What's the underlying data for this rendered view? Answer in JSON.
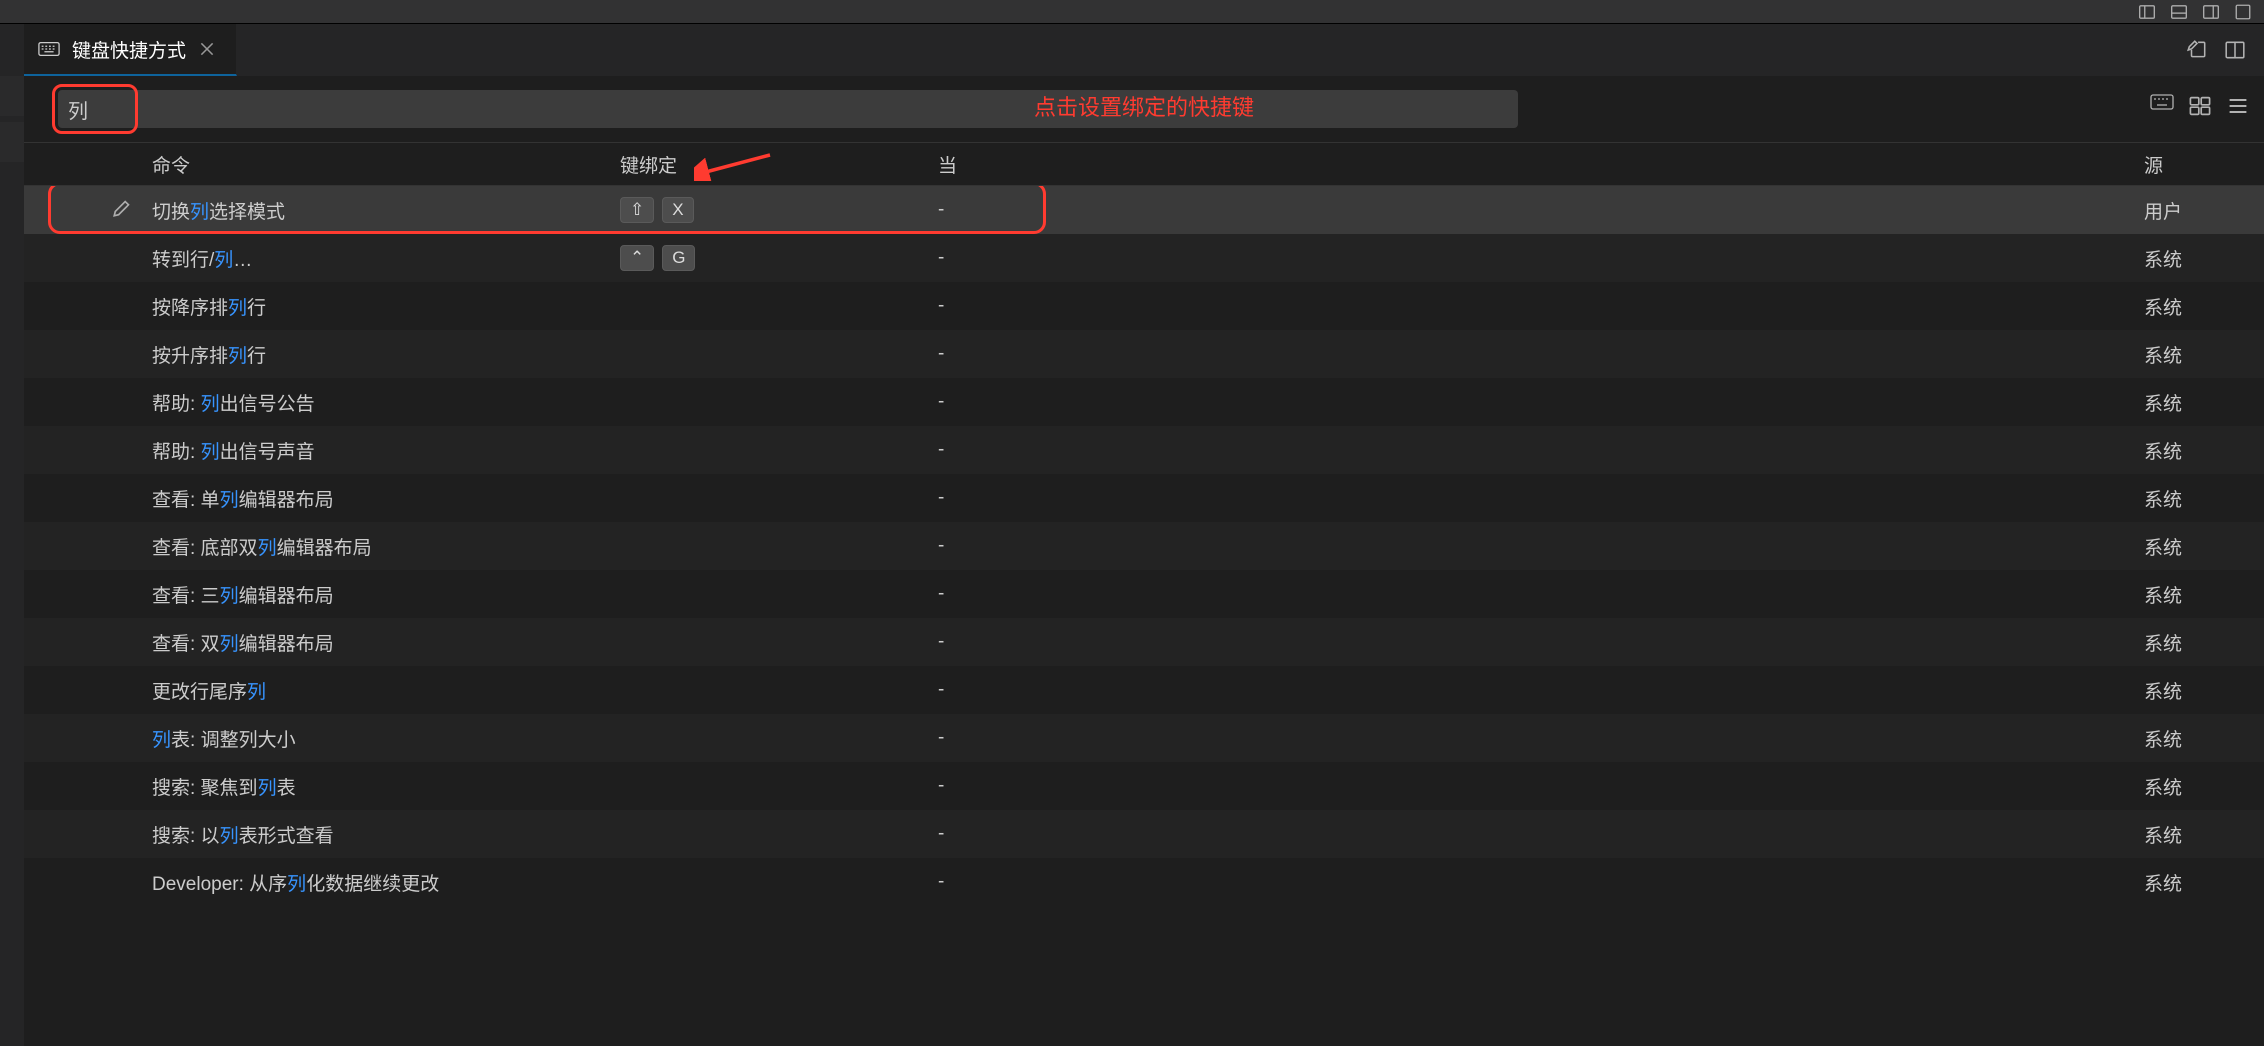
{
  "tab": {
    "title": "键盘快捷方式"
  },
  "search": {
    "value": "列",
    "annotation": "点击设置绑定的快捷键"
  },
  "headers": {
    "command": "命令",
    "keybinding": "键绑定",
    "when": "当",
    "source": "源"
  },
  "source_labels": {
    "user": "用户",
    "system": "系统"
  },
  "rows": [
    {
      "selected": true,
      "edit_icon": true,
      "cmd_parts": [
        "切换",
        "列",
        "选择模式"
      ],
      "keys": [
        "⇧",
        "X"
      ],
      "when": "-",
      "source_key": "user"
    },
    {
      "cmd_parts": [
        "转到行/",
        "列",
        "…"
      ],
      "keys": [
        "⌃",
        "G"
      ],
      "when": "-",
      "source_key": "system"
    },
    {
      "cmd_parts": [
        "按降序排",
        "列",
        "行"
      ],
      "keys": [],
      "when": "-",
      "source_key": "system"
    },
    {
      "cmd_parts": [
        "按升序排",
        "列",
        "行"
      ],
      "keys": [],
      "when": "-",
      "source_key": "system"
    },
    {
      "cmd_parts": [
        "帮助: ",
        "列",
        "出信号公告"
      ],
      "keys": [],
      "when": "-",
      "source_key": "system"
    },
    {
      "cmd_parts": [
        "帮助: ",
        "列",
        "出信号声音"
      ],
      "keys": [],
      "when": "-",
      "source_key": "system"
    },
    {
      "cmd_parts": [
        "查看: 单",
        "列",
        "编辑器布局"
      ],
      "keys": [],
      "when": "-",
      "source_key": "system"
    },
    {
      "cmd_parts": [
        "查看: 底部双",
        "列",
        "编辑器布局"
      ],
      "keys": [],
      "when": "-",
      "source_key": "system"
    },
    {
      "cmd_parts": [
        "查看: 三",
        "列",
        "编辑器布局"
      ],
      "keys": [],
      "when": "-",
      "source_key": "system"
    },
    {
      "cmd_parts": [
        "查看: 双",
        "列",
        "编辑器布局"
      ],
      "keys": [],
      "when": "-",
      "source_key": "system"
    },
    {
      "cmd_parts": [
        "更改行尾序",
        "列",
        ""
      ],
      "keys": [],
      "when": "-",
      "source_key": "system"
    },
    {
      "cmd_parts": [
        "",
        "列",
        "表: 调整列大小"
      ],
      "keys": [],
      "when": "-",
      "source_key": "system"
    },
    {
      "cmd_parts": [
        "搜索: 聚焦到",
        "列",
        "表"
      ],
      "keys": [],
      "when": "-",
      "source_key": "system"
    },
    {
      "cmd_parts": [
        "搜索: 以",
        "列",
        "表形式查看"
      ],
      "keys": [],
      "when": "-",
      "source_key": "system"
    },
    {
      "cmd_parts": [
        "Developer: 从序",
        "列",
        "化数据继续更改"
      ],
      "keys": [],
      "when": "-",
      "source_key": "system"
    }
  ]
}
